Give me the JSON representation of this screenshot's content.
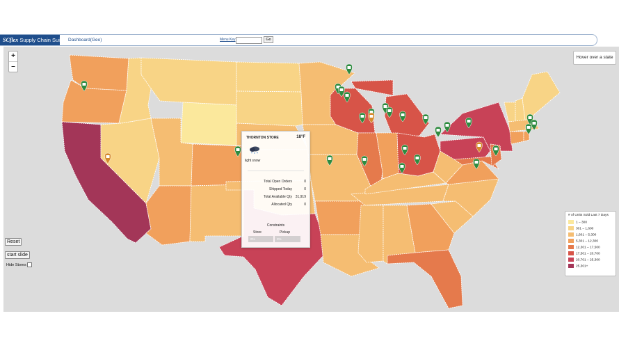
{
  "header": {
    "brand_prefix": "SC",
    "brand_flex": "flex",
    "brand_rest": "Supply Chain Suite",
    "dashboard_title": "Dashboard(Geo)",
    "menu_key_label": "Menu Key",
    "menu_key_value": "",
    "go_label": "Go"
  },
  "map": {
    "zoom_in": "+",
    "zoom_out": "–",
    "hover_hint": "Hover over a state",
    "colors": {
      "l1": "#fbe89c",
      "l2": "#f8d486",
      "l3": "#f5bd72",
      "l4": "#f1a05c",
      "l5": "#e57a4c",
      "l6": "#d75448",
      "l7": "#c84257",
      "l8": "#a33658",
      "sea": "#dcdcdc",
      "store_pin": "#2e8b3f",
      "warehouse_pin": "#d58a2c"
    }
  },
  "controls": {
    "reset": "Reset",
    "start_slide": "start slide",
    "hide_stores": "Hide Stores"
  },
  "popup": {
    "store_name": "THORNTON STORE",
    "temperature": "18°F",
    "condition": "light snow",
    "weather_icon": "snow-cloud-icon",
    "stats": [
      {
        "label": "Total Open Orders",
        "value": "0"
      },
      {
        "label": "Shipped Today",
        "value": "0"
      },
      {
        "label": "Total Available Qty",
        "value": "31,919"
      },
      {
        "label": "Allocated Qty",
        "value": "0"
      }
    ],
    "constraints_title": "Constraints",
    "store_label": "Store",
    "pickup_label": "Pickup",
    "store_value": "0%",
    "pickup_value": "0%"
  },
  "legend": {
    "title": "# of Units Sold Last 7 Days",
    "items": [
      {
        "label": "1 – 300",
        "color": "#fbe89c"
      },
      {
        "label": "301 – 1,600",
        "color": "#f8d486"
      },
      {
        "label": "1,601 – 5,300",
        "color": "#f5bd72"
      },
      {
        "label": "5,301 – 12,300",
        "color": "#f1a05c"
      },
      {
        "label": "12,301 – 17,500",
        "color": "#e57a4c"
      },
      {
        "label": "17,501 – 20,700",
        "color": "#d75448"
      },
      {
        "label": "20,701 – 25,300",
        "color": "#c84257"
      },
      {
        "label": "25,301+",
        "color": "#a33658"
      }
    ]
  }
}
